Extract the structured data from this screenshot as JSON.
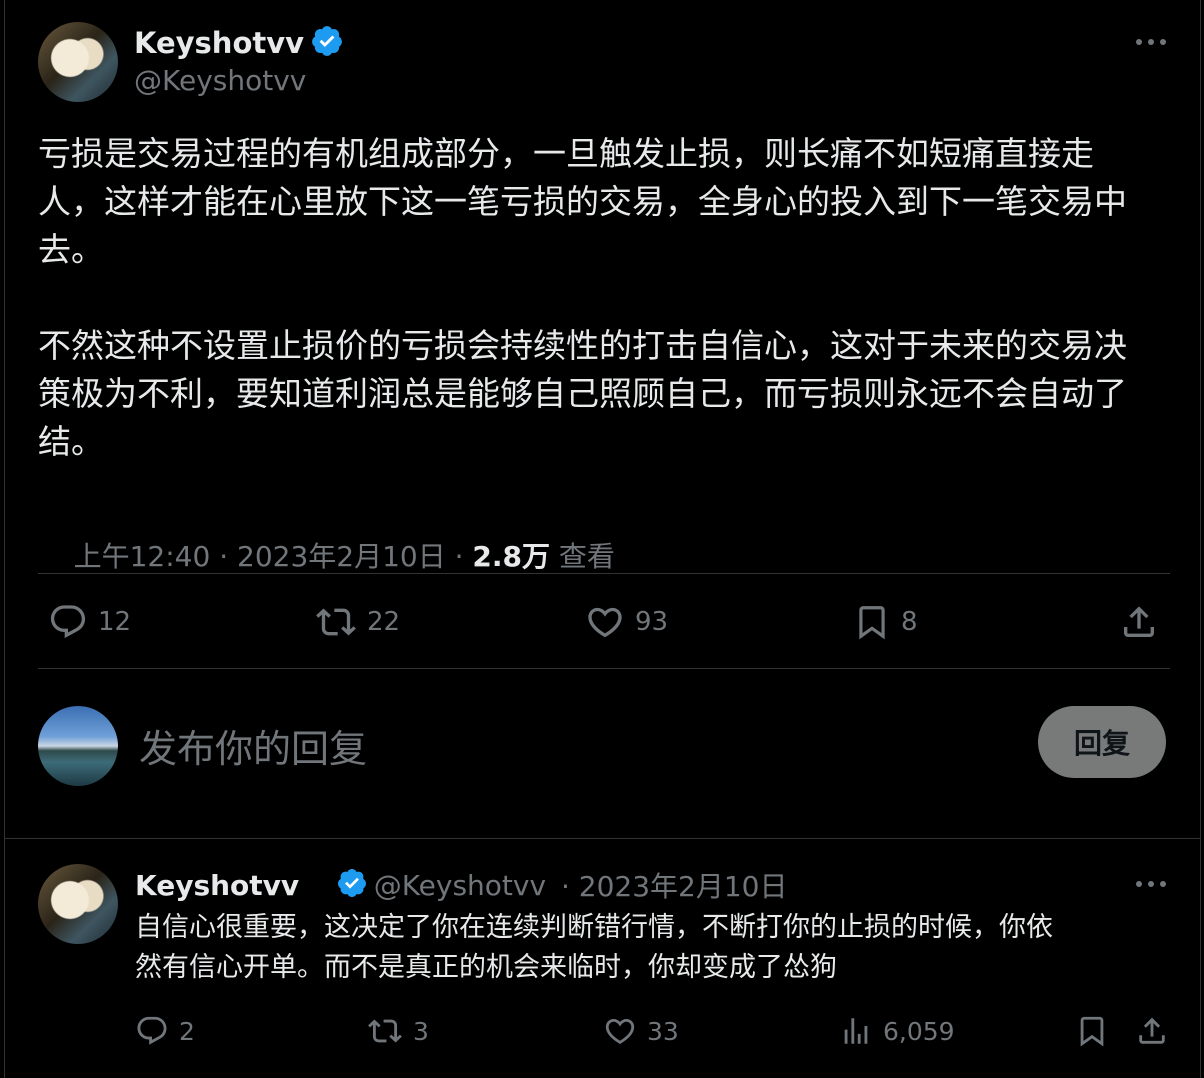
{
  "tweet": {
    "author_name": "Keyshotvv",
    "author_handle": "@Keyshotvv",
    "paragraph1": "亏损是交易过程的有机组成部分，一旦触发止损，则长痛不如短痛直接走\n人，这样才能在心里放下这一笔亏损的交易，全身心的投入到下一笔交易中\n去。",
    "paragraph2": "不然这种不设置止损价的亏损会持续性的打击自信心，这对于未来的交易决\n策极为不利，要知道利润总是能够自己照顾自己，而亏损则永远不会自动了\n结。",
    "time": "上午12:40 · 2023年2月10日 · ",
    "views_count": "2.8万",
    "views_label": " 查看",
    "actions": {
      "reply_count": "12",
      "retweet_count": "22",
      "like_count": "93",
      "bookmark_count": "8"
    }
  },
  "composer": {
    "placeholder": "发布你的回复",
    "reply_button": "回复"
  },
  "reply": {
    "author_name": "Keyshotvv",
    "author_handle": "@Keyshotvv",
    "date": " · 2023年2月10日",
    "text": "自信心很重要，这决定了你在连续判断错行情，不断打你的止损的时候，你依\n然有信心开单。而不是真正的机会来临时，你却变成了怂狗",
    "actions": {
      "reply_count": "2",
      "retweet_count": "3",
      "like_count": "33",
      "views_count": "6,059"
    }
  },
  "colors": {
    "background": "#000000",
    "text": "#e7e9ea",
    "muted": "#71767b",
    "verified": "#1d9bf0",
    "divider": "#2f3336"
  }
}
